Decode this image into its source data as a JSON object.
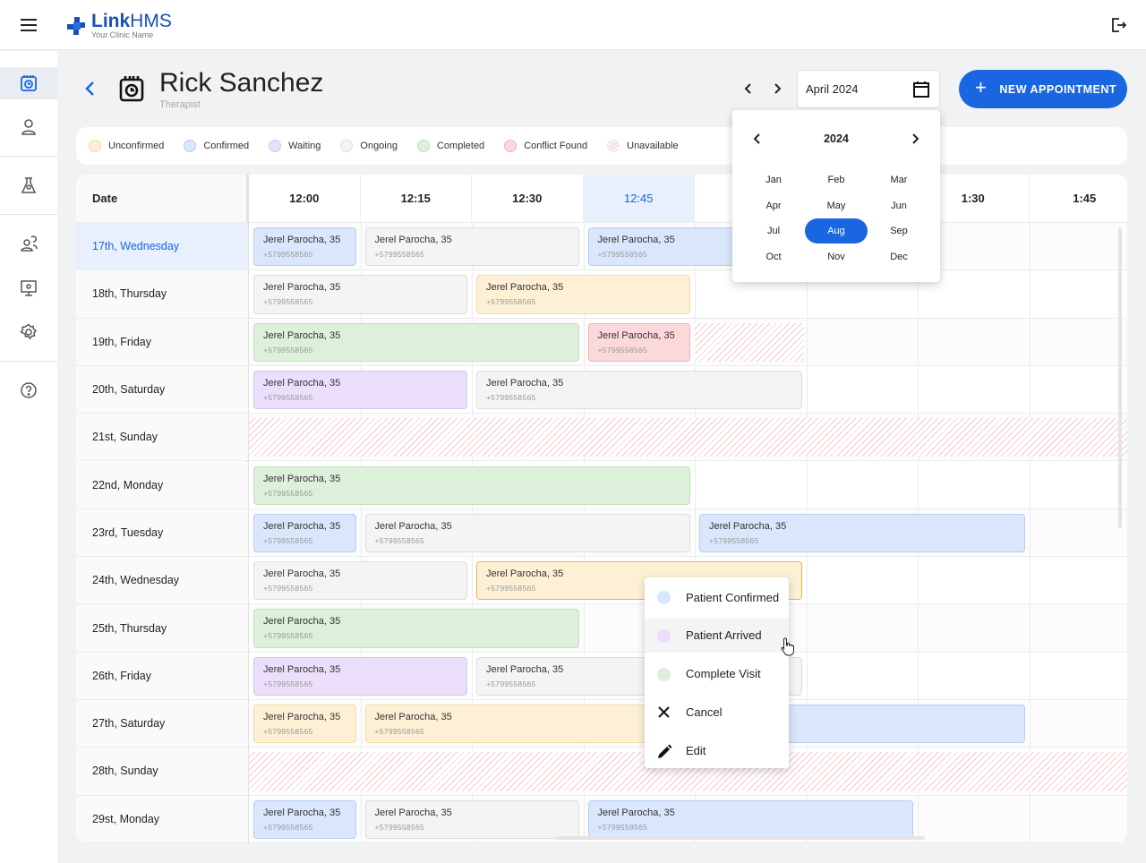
{
  "brand": {
    "name_a": "Link",
    "name_b": "HMS",
    "clinic": "Your Clinic Name",
    "accent": "#1a66e0"
  },
  "sidebar": {
    "items": [
      "calendar-clock",
      "user",
      "lab-flask",
      "users-group",
      "monitor",
      "settings",
      "help"
    ]
  },
  "header": {
    "title": "Rick Sanchez",
    "subtitle": "Therapist",
    "month_value": "April 2024",
    "new_appointment": "NEW APPOINTMENT"
  },
  "legend": [
    {
      "label": "Unconfirmed",
      "color": "#fdf0d5"
    },
    {
      "label": "Confirmed",
      "color": "#d9e6fb"
    },
    {
      "label": "Waiting",
      "color": "#ecdffb"
    },
    {
      "label": "Ongoing",
      "color": "#f4f4f4"
    },
    {
      "label": "Completed",
      "color": "#ddf0da"
    },
    {
      "label": "Conflict Found",
      "color": "#fbd9db"
    },
    {
      "label": "Unavailable",
      "color": "hatched"
    }
  ],
  "grid": {
    "date_header": "Date",
    "times": [
      "12:00",
      "12:15",
      "12:30",
      "12:45",
      "",
      "",
      "1:30",
      "1:45"
    ],
    "highlight_time": 3,
    "rows": [
      {
        "date": "17th, Wednesday",
        "today": true,
        "appts": [
          [
            0,
            1,
            "confirmed"
          ],
          [
            1,
            2,
            "ongoing"
          ],
          [
            3,
            2,
            "confirmed"
          ]
        ]
      },
      {
        "date": "18th, Thursday",
        "appts": [
          [
            0,
            2,
            "ongoing"
          ],
          [
            2,
            2,
            "unconfirmed"
          ]
        ]
      },
      {
        "date": "19th, Friday",
        "appts": [
          [
            0,
            3,
            "completed"
          ],
          [
            3,
            1,
            "conflict"
          ]
        ],
        "unavail": [
          4,
          1
        ]
      },
      {
        "date": "20th, Saturday",
        "appts": [
          [
            0,
            2,
            "waiting"
          ],
          [
            2,
            3,
            "ongoing"
          ]
        ]
      },
      {
        "date": "21st, Sunday",
        "appts": [],
        "unavail": [
          0,
          8
        ]
      },
      {
        "date": "22nd, Monday",
        "appts": [
          [
            0,
            4,
            "completed"
          ]
        ]
      },
      {
        "date": "23rd, Tuesday",
        "appts": [
          [
            0,
            1,
            "confirmed"
          ],
          [
            1,
            3,
            "ongoing"
          ],
          [
            4,
            3,
            "confirmed"
          ]
        ]
      },
      {
        "date": "24th, Wednesday",
        "appts": [
          [
            0,
            2,
            "ongoing"
          ],
          [
            2,
            3,
            "unconfirmed",
            "selected"
          ]
        ]
      },
      {
        "date": "25th, Thursday",
        "appts": [
          [
            0,
            3,
            "completed"
          ]
        ]
      },
      {
        "date": "26th, Friday",
        "appts": [
          [
            0,
            2,
            "waiting"
          ],
          [
            2,
            3,
            "ongoing"
          ]
        ]
      },
      {
        "date": "27th, Saturday",
        "appts": [
          [
            0,
            1,
            "unconfirmed"
          ],
          [
            1,
            3,
            "unconfirmed"
          ],
          [
            4,
            3,
            "confirmed"
          ]
        ]
      },
      {
        "date": "28th, Sunday",
        "appts": [],
        "unavail": [
          0,
          8
        ]
      },
      {
        "date": "29st, Monday",
        "appts": [
          [
            0,
            1,
            "confirmed"
          ],
          [
            1,
            2,
            "ongoing"
          ],
          [
            3,
            3,
            "confirmed"
          ]
        ]
      }
    ],
    "patient_name": "Jerel Parocha, 35",
    "patient_phone": "+5799558565"
  },
  "status_colors": {
    "unconfirmed": [
      "#fdf0d5",
      "#f3dca6"
    ],
    "confirmed": [
      "#d9e6fb",
      "#b7cdf3"
    ],
    "waiting": [
      "#ecdffb",
      "#d6c3f3"
    ],
    "ongoing": [
      "#f4f4f4",
      "#dcdcdc"
    ],
    "completed": [
      "#ddf0da",
      "#c2e0bd"
    ],
    "conflict": [
      "#fbd9db",
      "#f0b2b7"
    ]
  },
  "month_picker": {
    "year": "2024",
    "months": [
      "Jan",
      "Feb",
      "Mar",
      "Apr",
      "May",
      "Jun",
      "Jul",
      "Aug",
      "Sep",
      "Oct",
      "Nov",
      "Dec"
    ],
    "selected": "Aug"
  },
  "context_menu": [
    {
      "label": "Patient Confirmed",
      "icon": "dot",
      "color": "#d9e6fb"
    },
    {
      "label": "Patient Arrived",
      "icon": "dot",
      "color": "#ecdffb",
      "hover": true
    },
    {
      "label": "Complete Visit",
      "icon": "dot",
      "color": "#ddf0da"
    },
    {
      "label": "Cancel",
      "icon": "close"
    },
    {
      "label": "Edit",
      "icon": "pencil"
    }
  ]
}
